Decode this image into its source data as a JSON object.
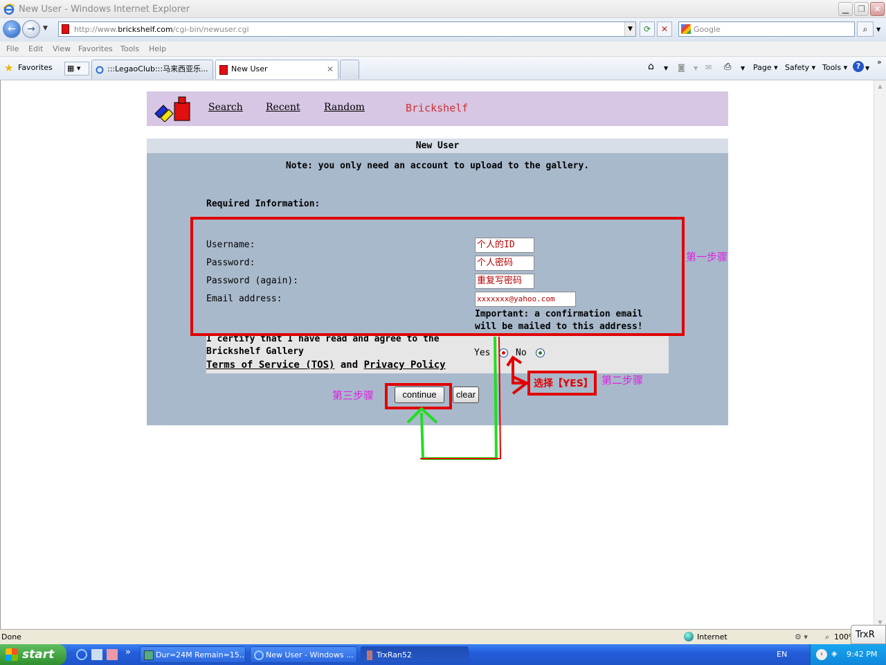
{
  "window": {
    "title": "New User - Windows Internet Explorer"
  },
  "navbar": {
    "url_prefix": "http://www.",
    "url_domain": "brickshelf.com",
    "url_path": "/cgi-bin/newuser.cgi",
    "search_placeholder": "Google"
  },
  "menu": [
    "File",
    "Edit",
    "View",
    "Favorites",
    "Tools",
    "Help"
  ],
  "favbar": {
    "favorites_label": "Favorites",
    "tabs": [
      {
        "label": ":::LegaoClub:::马来西亚乐..."
      },
      {
        "label": "New User"
      }
    ],
    "commands": {
      "page": "Page",
      "safety": "Safety",
      "tools": "Tools"
    }
  },
  "site_header": {
    "links": [
      "Search",
      "Recent",
      "Random"
    ],
    "brand": "Brickshelf"
  },
  "form": {
    "title": "New User",
    "note": "Note: you only need an account to upload to the gallery.",
    "section_heading": "Required Information:",
    "fields": [
      {
        "label": "Username:",
        "value": "个人的ID"
      },
      {
        "label": "Password:",
        "value": "个人密码"
      },
      {
        "label": "Password (again):",
        "value": "重复写密码"
      },
      {
        "label": "Email address:",
        "value": "xxxxxxx@yahoo.com"
      }
    ],
    "email_note_line1": "Important: a confirmation email",
    "email_note_line2": "will be mailed to this address!",
    "certify_line1": "I certify that I have read and agree to the",
    "certify_line2": "Brickshelf Gallery",
    "tos_link": "Terms of Service (TOS)",
    "and_text": "and",
    "privacy_link": "Privacy Policy",
    "yes_label": "Yes",
    "no_label": "No",
    "continue_button": "continue",
    "clear_button": "clear"
  },
  "annotations": {
    "step1": "第一步骤",
    "step2": "第二步骤",
    "step3": "第三步骤",
    "choose_yes": "选择【YES】"
  },
  "statusbar": {
    "status": "Done",
    "zone": "Internet",
    "zoom": "100%"
  },
  "taskbar": {
    "start": "start",
    "tasks": [
      "Dur=24M Remain=15...",
      "New User - Windows ...",
      "TrxRan52"
    ],
    "lang": "EN",
    "clock": "9:42 PM",
    "floating_label": "TrxR"
  },
  "colors": {
    "header_bg": "#d7c6e4",
    "form_bg": "#a9b9cc",
    "annotation_red": "#e00000",
    "annotation_green": "#22dd22",
    "annotation_magenta": "#e020e0"
  }
}
